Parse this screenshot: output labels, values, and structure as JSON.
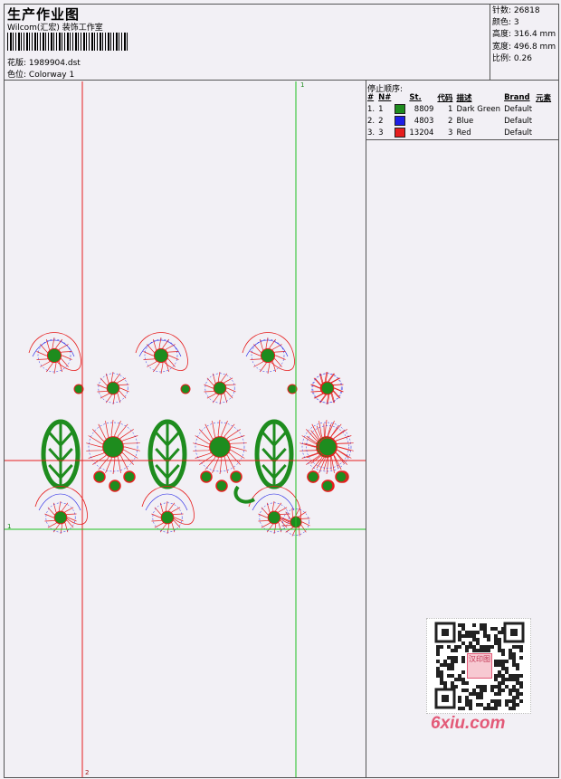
{
  "header": {
    "title": "生产作业图",
    "company": "Wilcom(汇宏) 装饰工作室",
    "design_label": "花版:",
    "design_value": "1989904.dst",
    "colorway_label": "色位:",
    "colorway_value": "Colorway 1"
  },
  "stats": [
    {
      "label": "针数:",
      "value": "26818"
    },
    {
      "label": "颜色:",
      "value": "3"
    },
    {
      "label": "高度:",
      "value": "316.4 mm"
    },
    {
      "label": "宽度:",
      "value": "496.8 mm"
    },
    {
      "label": "比例:",
      "value": "0.26"
    }
  ],
  "stop_sequence": {
    "heading": "停止顺序:",
    "columns": [
      "#",
      "N#",
      "St.",
      "代码",
      "描述",
      "Brand",
      "元素"
    ],
    "rows": [
      {
        "idx": "1.",
        "n": "1",
        "color": "#1e8c1e",
        "stitches": "8809",
        "code": "1",
        "desc": "Dark Green",
        "brand": "Default"
      },
      {
        "idx": "2.",
        "n": "2",
        "color": "#1e1ee6",
        "stitches": "4803",
        "code": "2",
        "desc": "Blue",
        "brand": "Default"
      },
      {
        "idx": "3.",
        "n": "3",
        "color": "#e61e1e",
        "stitches": "13204",
        "code": "3",
        "desc": "Red",
        "brand": "Default"
      }
    ]
  },
  "guides": {
    "top_marker": "1",
    "left_marker": "1",
    "bottom_marker": "2"
  },
  "watermark": {
    "text": "6xiu.com",
    "qr_badge": "汉印图"
  }
}
